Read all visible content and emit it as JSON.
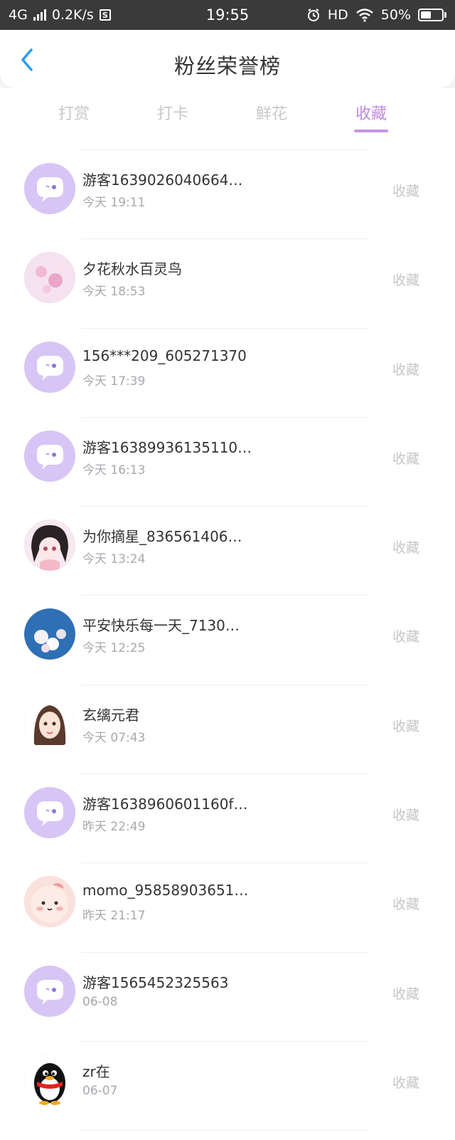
{
  "status_bar": {
    "network": "4G",
    "speed": "0.2K/s",
    "time": "19:55",
    "hd": "HD",
    "battery": "50%",
    "battery_level": 0.5
  },
  "header": {
    "title": "粉丝荣誉榜"
  },
  "tabs": [
    {
      "label": "打赏",
      "active": false
    },
    {
      "label": "打卡",
      "active": false
    },
    {
      "label": "鲜花",
      "active": false
    },
    {
      "label": "收藏",
      "active": true
    }
  ],
  "colors": {
    "accent": "#c18ae0",
    "avatar_default_bg": "#d9c6f5",
    "muted": "#c6c6ca"
  },
  "fans": [
    {
      "name": "游客1639026040664…",
      "time": "今天 19:11",
      "action": "收藏",
      "avatar": "default-chat-avatar-icon"
    },
    {
      "name": "夕花秋水百灵鸟",
      "time": "今天 18:53",
      "action": "收藏",
      "avatar": "pink-flower-avatar"
    },
    {
      "name": "156***209_605271370",
      "time": "今天 17:39",
      "action": "收藏",
      "avatar": "default-chat-avatar-icon"
    },
    {
      "name": "游客16389936135110…",
      "time": "今天 16:13",
      "action": "收藏",
      "avatar": "default-chat-avatar-icon"
    },
    {
      "name": "为你摘星_836561406…",
      "time": "今天 13:24",
      "action": "收藏",
      "avatar": "anime-girl-avatar"
    },
    {
      "name": "平安快乐每一天_7130…",
      "time": "今天 12:25",
      "action": "收藏",
      "avatar": "sky-blossom-avatar"
    },
    {
      "name": "玄缡元君",
      "time": "今天 07:43",
      "action": "收藏",
      "avatar": "cartoon-girl-avatar"
    },
    {
      "name": "游客1638960601160f…",
      "time": "昨天 22:49",
      "action": "收藏",
      "avatar": "default-chat-avatar-icon"
    },
    {
      "name": "momo_95858903651…",
      "time": "昨天 21:17",
      "action": "收藏",
      "avatar": "pink-chick-avatar"
    },
    {
      "name": "游客1565452325563",
      "time": "06-08",
      "action": "收藏",
      "avatar": "default-chat-avatar-icon"
    },
    {
      "name": "zr在",
      "time": "06-07",
      "action": "收藏",
      "avatar": "qq-penguin-avatar"
    }
  ]
}
